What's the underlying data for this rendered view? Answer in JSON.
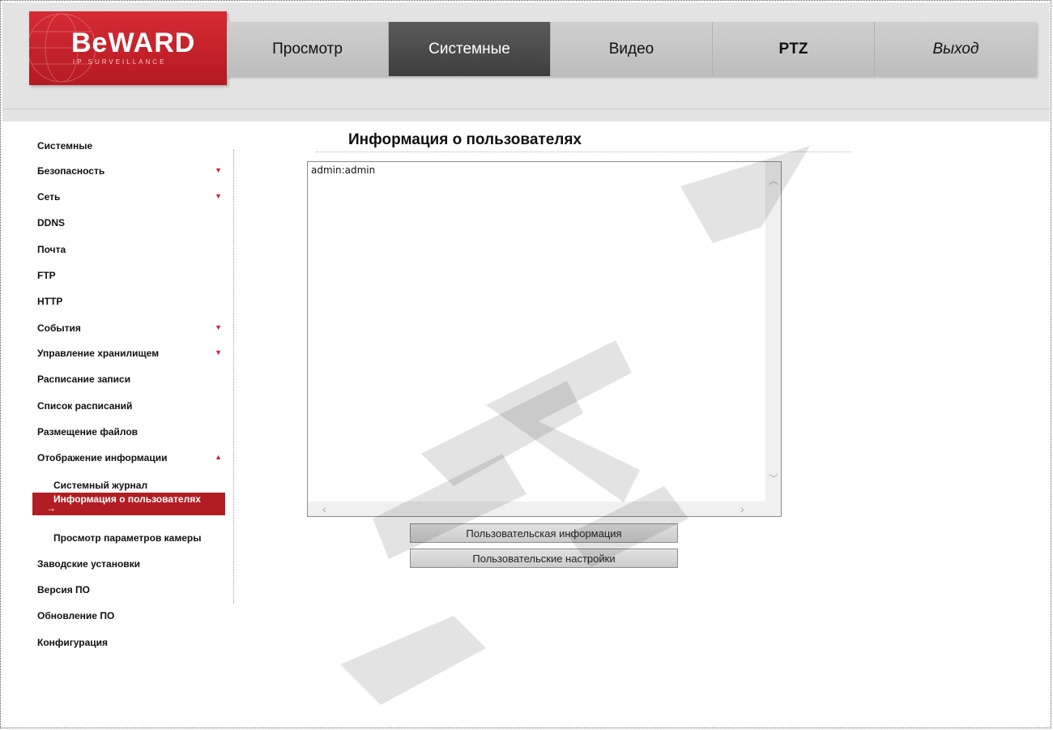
{
  "brand": {
    "name": "BeWARD",
    "tagline": "IP SURVEILLANCE"
  },
  "nav": {
    "tabs": [
      {
        "label": "Просмотр"
      },
      {
        "label": "Системные"
      },
      {
        "label": "Видео"
      },
      {
        "label": "PTZ"
      },
      {
        "label": "Выход"
      }
    ],
    "active": "Системные"
  },
  "sidebar": {
    "items": [
      {
        "label": "Системные"
      },
      {
        "label": "Безопасность",
        "arrow": "▼"
      },
      {
        "label": "Сеть",
        "arrow": "▼"
      },
      {
        "label": "DDNS"
      },
      {
        "label": "Почта"
      },
      {
        "label": "FTP"
      },
      {
        "label": "HTTP"
      },
      {
        "label": "События",
        "arrow": "▼"
      },
      {
        "label": "Управление хранилищем",
        "arrow": "▼"
      },
      {
        "label": "Расписание записи"
      },
      {
        "label": "Список расписаний"
      },
      {
        "label": "Размещение файлов"
      },
      {
        "label": "Отображение информации",
        "arrow": "▲"
      },
      {
        "label": "Системный журнал"
      },
      {
        "label": "Информация о пользователях",
        "marker": "→"
      },
      {
        "label": "Просмотр параметров камеры"
      },
      {
        "label": "Заводские установки"
      },
      {
        "label": "Версия ПО"
      },
      {
        "label": "Обновление ПО"
      },
      {
        "label": "Конфигурация"
      }
    ]
  },
  "main": {
    "title": "Информация о пользователях",
    "users_text": "admin:admin",
    "buttons": {
      "user_info": "Пользовательская информация",
      "user_settings": "Пользовательские настройки"
    }
  },
  "colors": {
    "accent_red": "#b21d24",
    "nav_active": "#4a4a4a",
    "header_bg": "#e3e3e3"
  }
}
